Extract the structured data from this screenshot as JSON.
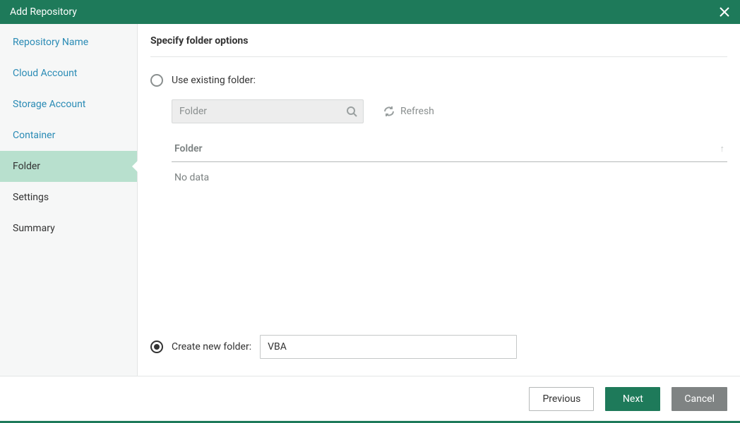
{
  "titlebar": {
    "title": "Add Repository"
  },
  "sidebar": {
    "items": [
      {
        "label": "Repository Name",
        "state": "link"
      },
      {
        "label": "Cloud Account",
        "state": "link"
      },
      {
        "label": "Storage Account",
        "state": "link"
      },
      {
        "label": "Container",
        "state": "link"
      },
      {
        "label": "Folder",
        "state": "active"
      },
      {
        "label": "Settings",
        "state": "done"
      },
      {
        "label": "Summary",
        "state": "done"
      }
    ]
  },
  "main": {
    "heading": "Specify folder options",
    "existing": {
      "label": "Use existing folder:",
      "selected": false,
      "search_placeholder": "Folder",
      "refresh_label": "Refresh",
      "column_header": "Folder",
      "empty_text": "No data"
    },
    "create": {
      "label": "Create new folder:",
      "selected": true,
      "value": "VBA"
    }
  },
  "footer": {
    "previous": "Previous",
    "next": "Next",
    "cancel": "Cancel"
  }
}
